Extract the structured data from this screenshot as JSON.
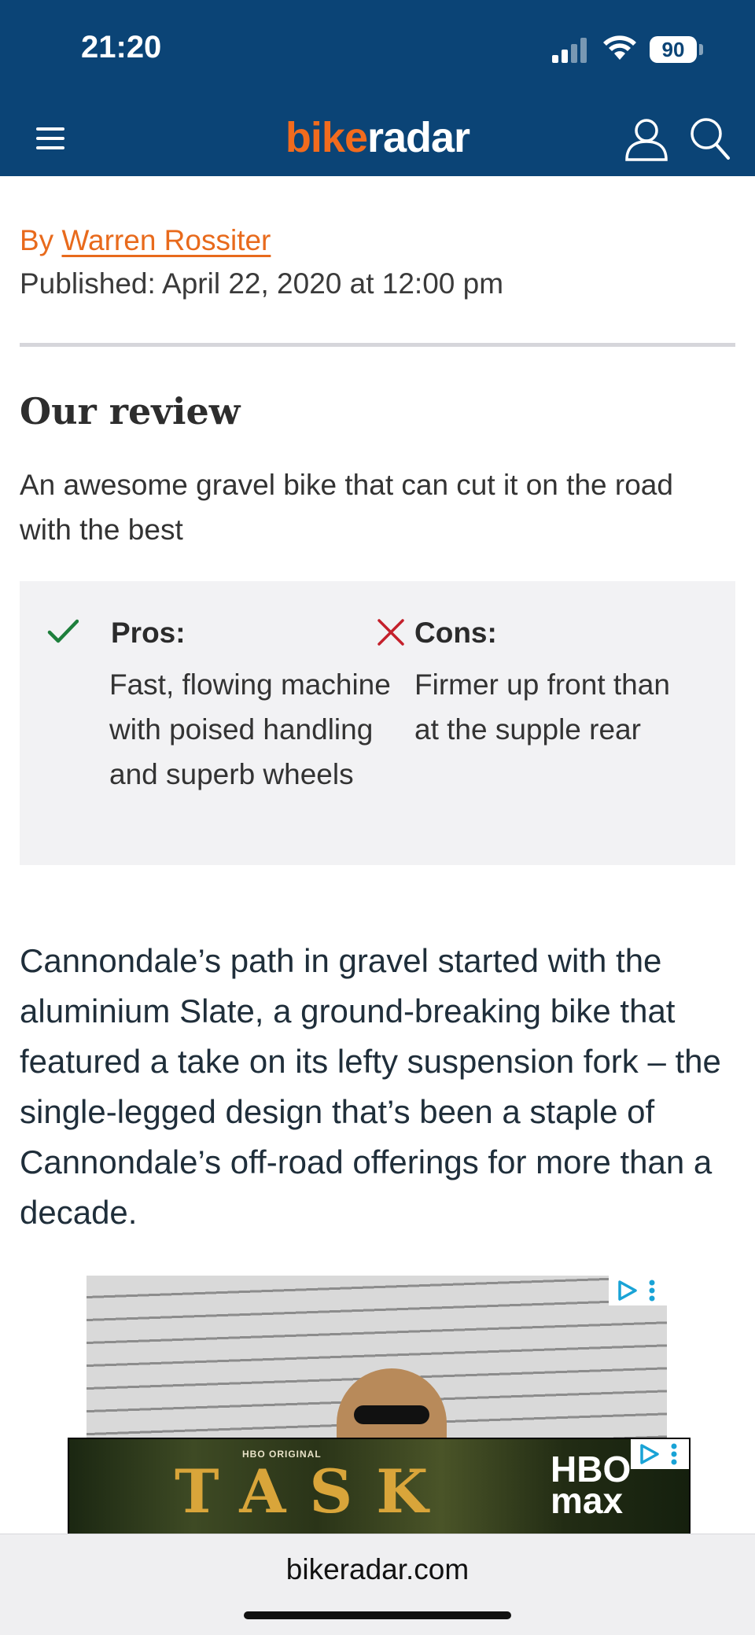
{
  "status_bar": {
    "time": "21:20",
    "battery": "90",
    "icons": [
      "signal-icon",
      "wifi-icon",
      "battery-icon"
    ]
  },
  "nav": {
    "logo_part1": "bike",
    "logo_part2": "radar",
    "icons": [
      "menu-icon",
      "account-icon",
      "search-icon"
    ],
    "colors": {
      "background": "#0b4476",
      "logo_accent": "#f26b1d"
    }
  },
  "article": {
    "byline_prefix": "By",
    "author": "Warren Rossiter",
    "published": "Published: April 22, 2020 at 12:00 pm",
    "review_heading": "Our review",
    "verdict": "An awesome gravel bike that can cut it on the road with the best",
    "pros_label": "Pros:",
    "pros_text": "Fast, flowing machine with poised handling and superb wheels",
    "cons_label": "Cons:",
    "cons_text": "Firmer up front than at the supple rear",
    "body": "Cannondale’s path in gravel started with the aluminium Slate, a ground-breaking bike that featured a take on its lefty suspension fork – the single-legged design that’s been a staple of Cannondale’s off-road offerings for more than a decade."
  },
  "banner": {
    "sub": "HBO ORIGINAL",
    "title": "TASK",
    "brand_line1": "HBO",
    "brand_line2": "max"
  },
  "browser": {
    "url": "bikeradar.com"
  }
}
